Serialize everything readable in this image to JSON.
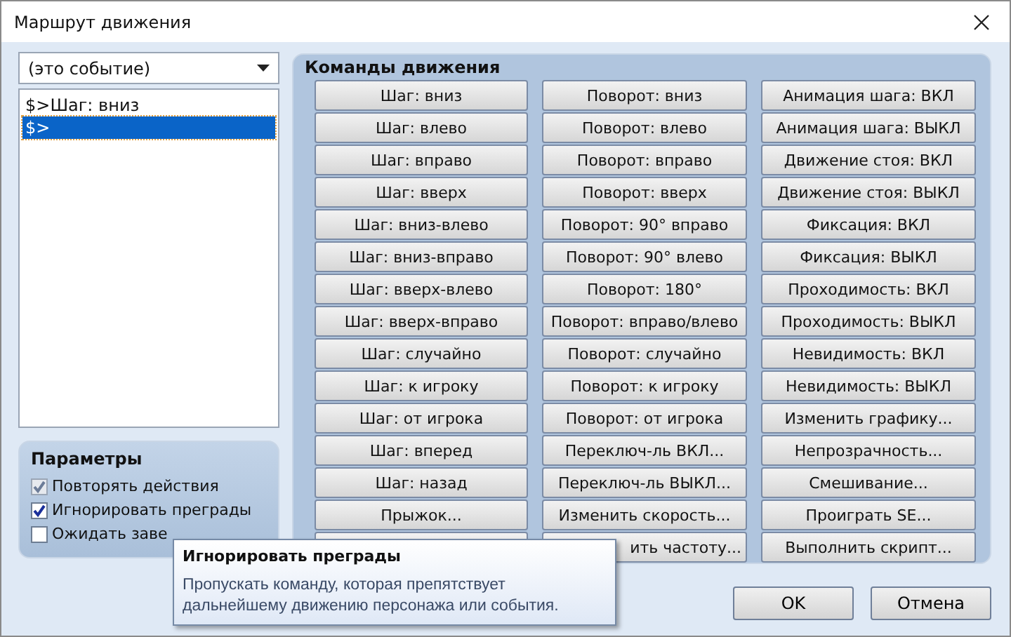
{
  "window": {
    "title": "Маршрут движения"
  },
  "event_select": {
    "value": "(это событие)"
  },
  "route_list": [
    {
      "text": "$>Шаг: вниз",
      "selected": false
    },
    {
      "text": "$>",
      "selected": true
    }
  ],
  "parameters": {
    "title": "Параметры",
    "options": [
      {
        "label": "Повторять действия",
        "checked": true,
        "disabled": true
      },
      {
        "label": "Игнорировать преграды",
        "checked": true,
        "disabled": false
      },
      {
        "label": "Ожидать заве",
        "checked": false,
        "disabled": false
      }
    ]
  },
  "commands": {
    "title": "Команды движения",
    "columns": [
      [
        {
          "label": "Шаг: вниз"
        },
        {
          "label": "Шаг: влево"
        },
        {
          "label": "Шаг: вправо"
        },
        {
          "label": "Шаг: вверх"
        },
        {
          "label": "Шаг: вниз-влево"
        },
        {
          "label": "Шаг: вниз-вправо"
        },
        {
          "label": "Шаг: вверх-влево"
        },
        {
          "label": "Шаг: вверх-вправо"
        },
        {
          "label": "Шаг: случайно"
        },
        {
          "label": "Шаг: к игроку"
        },
        {
          "label": "Шаг: от игрока"
        },
        {
          "label": "Шаг: вперед"
        },
        {
          "label": "Шаг: назад"
        },
        {
          "label": "Прыжок..."
        },
        {
          "covered": true
        }
      ],
      [
        {
          "label": "Поворот: вниз"
        },
        {
          "label": "Поворот: влево"
        },
        {
          "label": "Поворот: вправо"
        },
        {
          "label": "Поворот: вверх"
        },
        {
          "label": "Поворот: 90° вправо"
        },
        {
          "label": "Поворот: 90° влево"
        },
        {
          "label": "Поворот: 180°"
        },
        {
          "label": "Поворот: вправо/влево"
        },
        {
          "label": "Поворот: случайно"
        },
        {
          "label": "Поворот: к игроку"
        },
        {
          "label": "Поворот: от игрока"
        },
        {
          "label": "Переключ-ль ВКЛ..."
        },
        {
          "label": "Переключ-ль ВЫКЛ..."
        },
        {
          "label": "Изменить скорость..."
        },
        {
          "label": "ить частоту...",
          "covered": true
        }
      ],
      [
        {
          "label": "Анимация шага: ВКЛ"
        },
        {
          "label": "Анимация шага: ВЫКЛ"
        },
        {
          "label": "Движение стоя: ВКЛ"
        },
        {
          "label": "Движение стоя: ВЫКЛ"
        },
        {
          "label": "Фиксация: ВКЛ"
        },
        {
          "label": "Фиксация: ВЫКЛ"
        },
        {
          "label": "Проходимость: ВКЛ"
        },
        {
          "label": "Проходимость: ВЫКЛ"
        },
        {
          "label": "Невидимость: ВКЛ"
        },
        {
          "label": "Невидимость: ВЫКЛ"
        },
        {
          "label": "Изменить графику..."
        },
        {
          "label": "Непрозрачность..."
        },
        {
          "label": "Смешивание..."
        },
        {
          "label": "Проиграть SE..."
        },
        {
          "label": "Выполнить скрипт..."
        }
      ]
    ]
  },
  "tooltip": {
    "title": "Игнорировать преграды",
    "text": "Пропускать команду, которая препятствует дальнейшему движению персонажа или события."
  },
  "buttons": [
    "OK",
    "Отмена"
  ]
}
